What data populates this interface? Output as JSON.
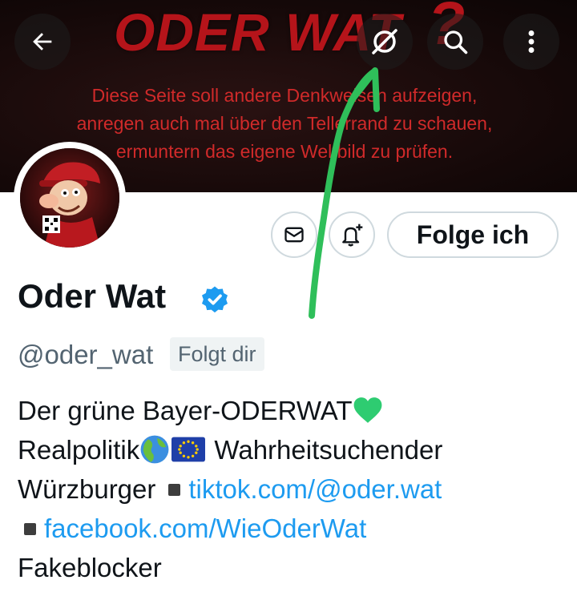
{
  "banner": {
    "title": "ODER WAT",
    "question_mark": "?",
    "lines": [
      "Diese Seite soll andere Denkweisen aufzeigen,",
      "anregen auch mal über den Tellerrand zu schauen,",
      "ermuntern das eigene Weltbild zu prüfen."
    ]
  },
  "topbar": {
    "back_icon": "back-arrow-icon",
    "grok_icon": "grok-icon",
    "search_icon": "search-icon",
    "more_icon": "more-vertical-icon"
  },
  "actions": {
    "message_icon": "envelope-icon",
    "notify_icon": "bell-plus-icon",
    "follow_label": "Folge ich"
  },
  "profile": {
    "name": "Oder Wat",
    "handle": "@oder_wat",
    "follows_you": "Folgt dir",
    "bio_line1_text": "Der grüne Bayer-ODERWAT",
    "bio_line1_emoji": "green-heart",
    "bio_line2_text": "Realpolitik",
    "bio_line2_emojis": [
      "earth-globe-europe-africa",
      "flag-european-union"
    ],
    "bio_line2_after": " Wahrheitsuchender",
    "bio_line3_text": "Würzburger",
    "link_tiktok": "tiktok.com/@oder.wat",
    "link_facebook": "facebook.com/WieOderWat",
    "bio_line5_text": "Fakeblocker"
  },
  "colors": {
    "banner_red": "#b5141a",
    "link_blue": "#1d9bf0",
    "verified_blue": "#1d9bf0",
    "annotation_green": "#2fbf5a",
    "text_dark": "#0f1419",
    "text_muted": "#536471"
  }
}
